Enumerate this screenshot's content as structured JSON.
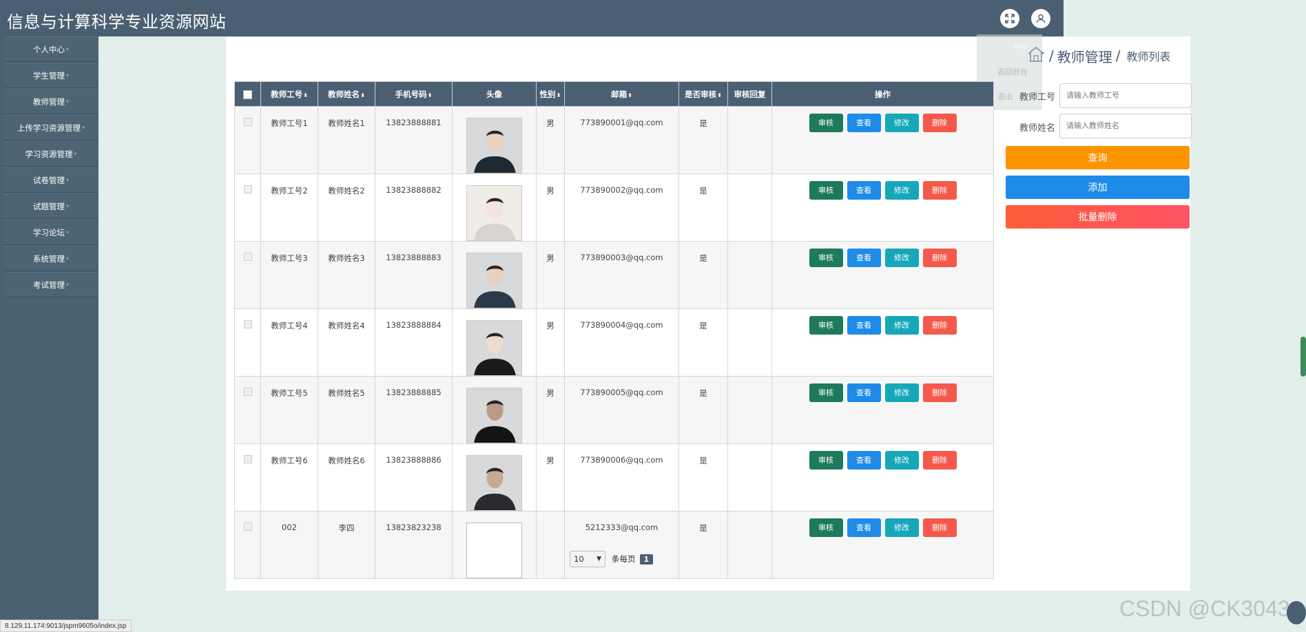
{
  "app": {
    "title": "信息与计算科学专业资源网站"
  },
  "header": {
    "fullscreen_icon": "fullscreen-icon",
    "user_icon": "user-icon"
  },
  "sidebar": {
    "items": [
      {
        "label": "个人中心"
      },
      {
        "label": "学生管理"
      },
      {
        "label": "教师管理"
      },
      {
        "label": "上传学习资源管理"
      },
      {
        "label": "学习资源管理"
      },
      {
        "label": "试卷管理"
      },
      {
        "label": "试题管理"
      },
      {
        "label": "学习论坛"
      },
      {
        "label": "系统管理"
      },
      {
        "label": "考试管理"
      }
    ]
  },
  "breadcrumb": {
    "home_icon": "home-icon",
    "section": "教师管理",
    "page": "教师列表"
  },
  "search": {
    "teacher_id_label": "教师工号",
    "teacher_id_placeholder": "请输入教师工号",
    "teacher_name_label": "教师姓名",
    "teacher_name_placeholder": "请输入教师姓名",
    "query_button": "查询",
    "add_button": "添加",
    "batch_delete_button": "批量删除"
  },
  "table": {
    "columns": [
      "教师工号",
      "教师姓名",
      "手机号码",
      "头像",
      "性别",
      "邮箱",
      "是否审核",
      "审核回复",
      "操作"
    ],
    "rows": [
      {
        "id": "教师工号1",
        "name": "教师姓名1",
        "phone": "13823888881",
        "gender": "男",
        "email": "773890001@qq.com",
        "audited": "是",
        "reply": ""
      },
      {
        "id": "教师工号2",
        "name": "教师姓名2",
        "phone": "13823888882",
        "gender": "男",
        "email": "773890002@qq.com",
        "audited": "是",
        "reply": ""
      },
      {
        "id": "教师工号3",
        "name": "教师姓名3",
        "phone": "13823888883",
        "gender": "男",
        "email": "773890003@qq.com",
        "audited": "是",
        "reply": ""
      },
      {
        "id": "教师工号4",
        "name": "教师姓名4",
        "phone": "13823888884",
        "gender": "男",
        "email": "773890004@qq.com",
        "audited": "是",
        "reply": ""
      },
      {
        "id": "教师工号5",
        "name": "教师姓名5",
        "phone": "13823888885",
        "gender": "男",
        "email": "773890005@qq.com",
        "audited": "是",
        "reply": ""
      },
      {
        "id": "教师工号6",
        "name": "教师姓名6",
        "phone": "13823888886",
        "gender": "男",
        "email": "773890006@qq.com",
        "audited": "是",
        "reply": ""
      },
      {
        "id": "002",
        "name": "李四",
        "phone": "13823823238",
        "gender": "",
        "email": "5212333@qq.com",
        "audited": "是",
        "reply": ""
      }
    ],
    "actions": {
      "audit": "审核",
      "view": "查看",
      "edit": "修改",
      "delete": "删除"
    }
  },
  "pager": {
    "page_size": "10",
    "per_page_label": "条每页",
    "current_page": "1"
  },
  "ghost_menu": {
    "item1": "abo",
    "item2": "返回前台",
    "item3": "退出"
  },
  "status_url": "8.129.11.174:9013/jspm9605o/index.jsp",
  "watermark": "CSDN @CK3043",
  "colors": {
    "header": "#4b5f72",
    "audit": "#1d7a5c",
    "view": "#1f8be8",
    "edit": "#16a8b8",
    "delete": "#f5594b",
    "query": "#fd9400",
    "add": "#1f8be8",
    "batch_delete": "#ff5366"
  }
}
